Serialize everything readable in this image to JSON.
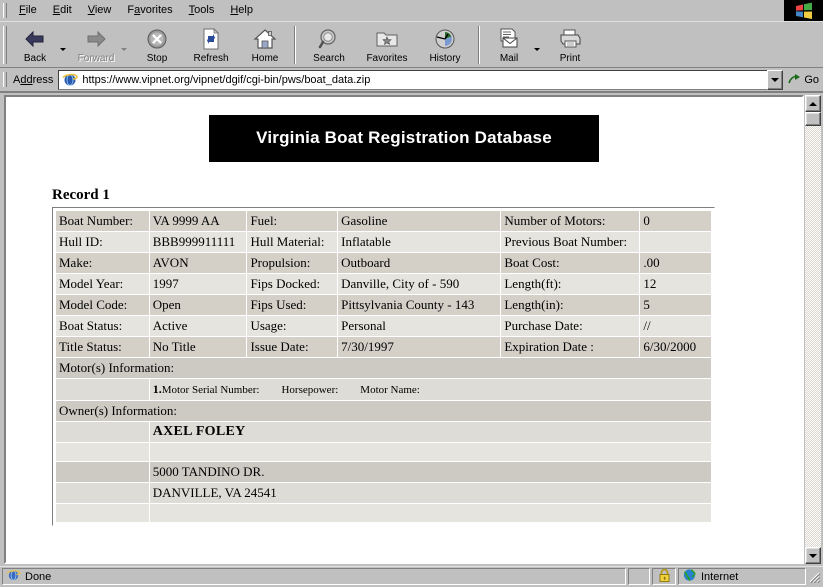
{
  "browser": {
    "menu": [
      {
        "label": "File",
        "accel": "F"
      },
      {
        "label": "Edit",
        "accel": "E"
      },
      {
        "label": "View",
        "accel": "V"
      },
      {
        "label": "Favorites",
        "accel": "a"
      },
      {
        "label": "Tools",
        "accel": "T"
      },
      {
        "label": "Help",
        "accel": "H"
      }
    ],
    "toolbar": [
      {
        "label": "Back",
        "icon": "back-arrow-icon",
        "disabled": false,
        "caret": true
      },
      {
        "label": "Forward",
        "icon": "forward-arrow-icon",
        "disabled": true,
        "caret": true
      },
      {
        "label": "Stop",
        "icon": "stop-icon",
        "disabled": false,
        "caret": false
      },
      {
        "label": "Refresh",
        "icon": "refresh-icon",
        "disabled": false,
        "caret": false
      },
      {
        "label": "Home",
        "icon": "home-icon",
        "disabled": false,
        "caret": false
      },
      {
        "label": "Search",
        "icon": "search-icon",
        "disabled": false,
        "caret": false
      },
      {
        "label": "Favorites",
        "icon": "favorites-folder-icon",
        "disabled": false,
        "caret": false
      },
      {
        "label": "History",
        "icon": "history-clock-icon",
        "disabled": false,
        "caret": false
      },
      {
        "label": "Mail",
        "icon": "mail-icon",
        "disabled": false,
        "caret": true
      },
      {
        "label": "Print",
        "icon": "printer-icon",
        "disabled": false,
        "caret": false
      }
    ],
    "address": {
      "label": "Address",
      "label_accel": "dd",
      "url": "https://www.vipnet.org/vipnet/dgif/cgi-bin/pws/boat_data.zip",
      "go_label": "Go"
    },
    "status": {
      "text": "Done",
      "zone": "Internet",
      "secure": true
    }
  },
  "page": {
    "banner_title": "Virginia Boat Registration Database",
    "banner_bg": "#000000",
    "banner_fg": "#ffffff",
    "record_heading": "Record 1",
    "fields": {
      "boat_number_label": "Boat Number:",
      "boat_number_value": "VA 9999 AA",
      "fuel_label": "Fuel:",
      "fuel_value": "Gasoline",
      "number_of_motors_label": "Number of Motors:",
      "number_of_motors_value": "0",
      "hull_id_label": "Hull ID:",
      "hull_id_value": "BBB999911111",
      "hull_material_label": "Hull Material:",
      "hull_material_value": "Inflatable",
      "previous_boat_number_label": "Previous Boat Number:",
      "previous_boat_number_value": "",
      "make_label": "Make:",
      "make_value": "AVON",
      "propulsion_label": "Propulsion:",
      "propulsion_value": "Outboard",
      "boat_cost_label": "Boat Cost:",
      "boat_cost_value": ".00",
      "model_year_label": "Model Year:",
      "model_year_value": "1997",
      "fips_docked_label": "Fips Docked:",
      "fips_docked_value": "Danville, City of - 590",
      "length_ft_label": "Length(ft):",
      "length_ft_value": "12",
      "model_code_label": "Model Code:",
      "model_code_value": "Open",
      "fips_used_label": "Fips Used:",
      "fips_used_value": "Pittsylvania County - 143",
      "length_in_label": "Length(in):",
      "length_in_value": "5",
      "boat_status_label": "Boat Status:",
      "boat_status_value": "Active",
      "usage_label": "Usage:",
      "usage_value": "Personal",
      "purchase_date_label": "Purchase Date:",
      "purchase_date_value": "//",
      "title_status_label": "Title Status:",
      "title_status_value": "No Title",
      "issue_date_label": "Issue Date:",
      "issue_date_value": "7/30/1997",
      "expiration_date_label": "Expiration Date :",
      "expiration_date_value": "6/30/2000",
      "motors_section_label": "Motor(s) Information:",
      "motor_index": "1.",
      "motor_serial_label": "Motor Serial Number:",
      "motor_horsepower_label": "Horsepower:",
      "motor_name_label": "Motor Name:",
      "owners_section_label": "Owner(s) Information:",
      "owner_name": "AXEL FOLEY",
      "owner_blank": "",
      "owner_address1": "5000 TANDINO DR.",
      "owner_address2": "DANVILLE, VA 24541",
      "owner_trailing": ""
    }
  },
  "scrollbar": {
    "up_arrow": "scroll-up-icon",
    "down_arrow": "scroll-down-icon",
    "thumb_position_percent": 0
  }
}
